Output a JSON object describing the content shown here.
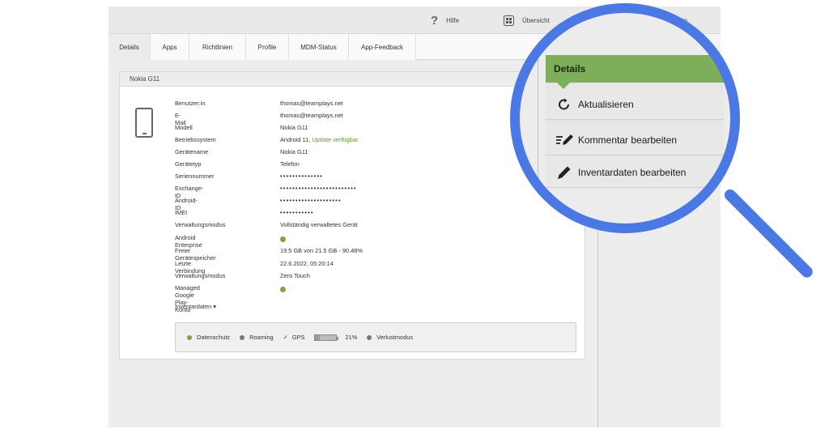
{
  "header": {
    "help_label": "Hilfe",
    "overview_label": "Übersicht",
    "account_label": "Konto"
  },
  "tabs": [
    {
      "label": "Details",
      "active": true
    },
    {
      "label": "Apps"
    },
    {
      "label": "Richtlinien"
    },
    {
      "label": "Profile"
    },
    {
      "label": "MDM-Status"
    },
    {
      "label": "App-Feedback"
    }
  ],
  "device": {
    "title": "Nokia G11",
    "rows": [
      {
        "label": "Benutzer:in",
        "value": "thomas@teamplays.net"
      },
      {
        "label": "E-Mail",
        "value": "thomas@teamplays.net"
      },
      {
        "label": "Modell",
        "value": "Nokia G11"
      },
      {
        "label": "Betriebssystem",
        "value": "Android 11,",
        "extra": "Update verfügbar"
      },
      {
        "label": "Gerätename",
        "value": "Nokia G11"
      },
      {
        "label": "Gerätetyp",
        "value": "Telefon"
      },
      {
        "label": "Seriennummer",
        "value": "••••••••••••••"
      },
      {
        "label": "Exchange-ID",
        "value": "•••••••••••••••••••••••••"
      },
      {
        "label": "Android-ID",
        "value": "••••••••••••••••••••"
      },
      {
        "label": "IMEI",
        "value": "•••••••••••"
      },
      {
        "label": "Verwaltungsmodus",
        "value": "Vollständig verwaltetes Gerät"
      },
      {
        "label": "Android Enterprise",
        "value": "",
        "status": "green"
      },
      {
        "label": "Freier Gerätespeicher",
        "value": "19.5 GB von 21.5 GB - 90.48%"
      },
      {
        "label": "Letzte Verbindung",
        "value": "22.6.2022, 05:20:14"
      },
      {
        "label": "Verwaltungsmodus",
        "value": "Zero Touch"
      },
      {
        "label": "Managed Google Play-Konto",
        "value": "",
        "status": "green"
      }
    ],
    "inventory_toggle": "Inventardaten ▾"
  },
  "statusbar": {
    "privacy": "Datenschutz",
    "roaming": "Roaming",
    "gps": "GPS",
    "battery_percent": "21%",
    "battery_level": 0.21,
    "lost_mode": "Verlustmodus"
  },
  "magnified_panel": {
    "header": "Details",
    "items": [
      {
        "label": "Aktualisieren",
        "icon": "refresh-icon"
      },
      {
        "label": "Kommentar bearbeiten",
        "icon": "edit-list-icon"
      },
      {
        "label": "Inventardaten bearbeiten",
        "icon": "pencil-icon"
      }
    ]
  },
  "colors": {
    "accent_green": "#7fae5a",
    "ok_green": "#5a9a2b",
    "lens_blue": "#4a79e6"
  }
}
